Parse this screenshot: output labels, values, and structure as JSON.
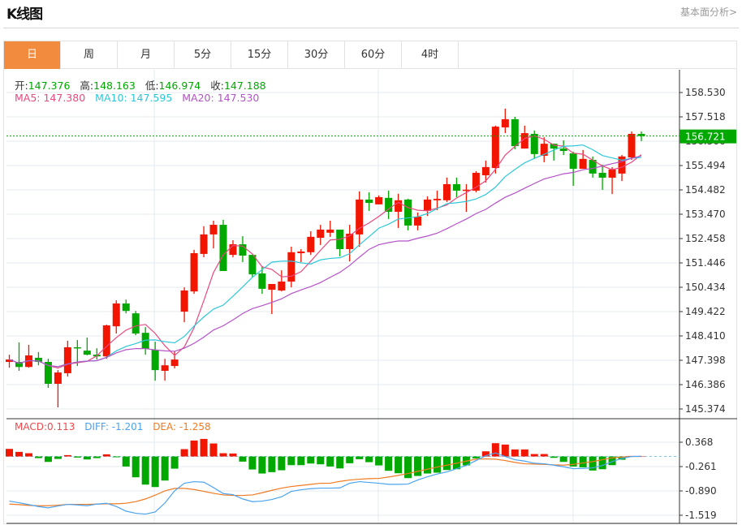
{
  "header": {
    "title": "K线图",
    "link": "基本面分析>"
  },
  "tabs": [
    {
      "label": "日",
      "active": true
    },
    {
      "label": "周"
    },
    {
      "label": "月"
    },
    {
      "label": "5分"
    },
    {
      "label": "15分"
    },
    {
      "label": "30分"
    },
    {
      "label": "60分"
    },
    {
      "label": "4时"
    }
  ],
  "ohlc": {
    "open_label": "开:",
    "open": "147.376",
    "high_label": "高:",
    "high": "148.163",
    "low_label": "低:",
    "low": "146.974",
    "close_label": "收:",
    "close": "147.188"
  },
  "ma": {
    "ma5": "MA5: 147.380",
    "ma10": "MA10: 147.595",
    "ma20": "MA20: 147.530"
  },
  "macd_info": {
    "macd": "MACD:0.113",
    "diff": "DIFF: -1.201",
    "dea": "DEA: -1.258"
  },
  "colors": {
    "up": "#f21500",
    "down": "#00a800",
    "ma5": "#e9487f",
    "ma10": "#2ec7d9",
    "ma20": "#b552c8",
    "diff": "#4aa3f0",
    "dea": "#f07a22",
    "active_tab": "#f38b3f",
    "grid": "#e3ebf2"
  },
  "chart_data": [
    {
      "type": "candlestick",
      "ylim": [
        145.374,
        158.53
      ],
      "yticks": [
        "158.530",
        "157.518",
        "156.506",
        "155.494",
        "154.482",
        "153.470",
        "152.458",
        "151.446",
        "150.434",
        "149.422",
        "148.410",
        "147.398",
        "146.386",
        "145.374"
      ],
      "last_price": "156.721",
      "grid": true,
      "ma_periods": [
        5,
        10,
        20
      ],
      "candles": [
        [
          147.33,
          147.63,
          147.09,
          147.43
        ],
        [
          147.33,
          148.14,
          146.96,
          147.12
        ],
        [
          147.12,
          148.04,
          147.09,
          147.6
        ],
        [
          147.5,
          147.74,
          147.19,
          147.33
        ],
        [
          147.33,
          147.46,
          146.25,
          146.42
        ],
        [
          146.42,
          146.99,
          145.44,
          146.89
        ],
        [
          146.86,
          148.21,
          146.72,
          147.94
        ],
        [
          147.94,
          148.24,
          147.16,
          147.9
        ],
        [
          147.8,
          148.34,
          147.6,
          147.63
        ],
        [
          147.63,
          147.9,
          147.43,
          147.56
        ],
        [
          147.56,
          148.88,
          147.46,
          148.85
        ],
        [
          148.81,
          149.89,
          148.51,
          149.76
        ],
        [
          149.76,
          149.92,
          149.35,
          149.45
        ],
        [
          149.35,
          149.45,
          148.44,
          148.51
        ],
        [
          148.54,
          148.78,
          147.63,
          147.87
        ],
        [
          147.84,
          148.17,
          146.55,
          146.99
        ],
        [
          146.96,
          147.46,
          146.55,
          147.19
        ],
        [
          147.16,
          147.77,
          147.06,
          147.43
        ],
        [
          149.42,
          150.43,
          148.98,
          150.3
        ],
        [
          150.26,
          151.99,
          150.16,
          151.85
        ],
        [
          151.82,
          152.97,
          151.68,
          152.63
        ],
        [
          152.63,
          153.2,
          152.05,
          153.03
        ],
        [
          153.03,
          153.24,
          151.11,
          151.11
        ],
        [
          151.78,
          152.39,
          151.68,
          152.22
        ],
        [
          152.22,
          152.56,
          151.48,
          151.75
        ],
        [
          151.78,
          151.78,
          150.84,
          150.97
        ],
        [
          151.01,
          151.31,
          150.16,
          150.37
        ],
        [
          150.33,
          150.57,
          149.32,
          150.57
        ],
        [
          150.3,
          151.14,
          150.26,
          150.67
        ],
        [
          150.67,
          152.12,
          150.43,
          151.89
        ],
        [
          151.85,
          152.02,
          151.48,
          151.92
        ],
        [
          151.89,
          152.76,
          151.78,
          152.53
        ],
        [
          152.49,
          153.03,
          152.19,
          152.83
        ],
        [
          152.7,
          153.2,
          152.53,
          152.83
        ],
        [
          152.83,
          152.83,
          151.72,
          152.02
        ],
        [
          152.02,
          153.03,
          151.51,
          152.66
        ],
        [
          152.63,
          154.42,
          152.12,
          154.08
        ],
        [
          154.08,
          154.38,
          153.61,
          153.94
        ],
        [
          153.88,
          154.25,
          153.88,
          154.18
        ],
        [
          154.15,
          154.45,
          153.27,
          153.57
        ],
        [
          153.57,
          154.32,
          152.9,
          154.05
        ],
        [
          154.08,
          154.11,
          152.8,
          153.0
        ],
        [
          153.0,
          153.54,
          152.8,
          153.37
        ],
        [
          153.61,
          154.21,
          153.4,
          154.08
        ],
        [
          154.05,
          154.45,
          153.64,
          154.11
        ],
        [
          154.05,
          154.99,
          153.98,
          154.72
        ],
        [
          154.72,
          154.99,
          154.18,
          154.45
        ],
        [
          154.45,
          154.72,
          153.57,
          154.49
        ],
        [
          154.45,
          155.26,
          154.38,
          155.19
        ],
        [
          155.09,
          155.7,
          154.79,
          155.43
        ],
        [
          155.39,
          157.15,
          155.16,
          157.11
        ],
        [
          157.08,
          157.86,
          156.84,
          157.42
        ],
        [
          157.42,
          157.52,
          156.17,
          156.3
        ],
        [
          156.2,
          157.15,
          156.2,
          156.84
        ],
        [
          156.81,
          156.95,
          155.77,
          155.97
        ],
        [
          155.9,
          156.67,
          155.63,
          156.4
        ],
        [
          156.4,
          156.4,
          155.7,
          156.2
        ],
        [
          156.2,
          156.54,
          155.93,
          156.1
        ],
        [
          156.0,
          156.07,
          154.65,
          155.36
        ],
        [
          155.36,
          156.14,
          155.36,
          155.77
        ],
        [
          155.73,
          155.87,
          154.99,
          155.16
        ],
        [
          155.19,
          155.53,
          154.48,
          154.99
        ],
        [
          154.99,
          155.43,
          154.31,
          155.33
        ],
        [
          155.16,
          155.93,
          154.85,
          155.87
        ],
        [
          155.83,
          156.91,
          155.73,
          156.81
        ],
        [
          156.81,
          156.91,
          156.51,
          156.72
        ]
      ]
    },
    {
      "type": "macd",
      "ylim": [
        -1.519,
        0.368
      ],
      "yticks": [
        "0.368",
        "-0.261",
        "-0.890",
        "-1.519"
      ],
      "histogram": [
        0.196,
        0.119,
        0.084,
        -0.042,
        -0.14,
        -0.063,
        0.035,
        -0.028,
        -0.077,
        -0.042,
        0.056,
        -0.021,
        -0.259,
        -0.538,
        -0.727,
        -0.79,
        -0.622,
        -0.315,
        0.189,
        0.412,
        0.454,
        0.336,
        0.084,
        0.077,
        -0.133,
        -0.336,
        -0.44,
        -0.405,
        -0.356,
        -0.224,
        -0.224,
        -0.182,
        -0.203,
        -0.259,
        -0.308,
        -0.175,
        -0.07,
        -0.147,
        -0.231,
        -0.37,
        -0.433,
        -0.559,
        -0.503,
        -0.44,
        -0.419,
        -0.35,
        -0.329,
        -0.231,
        -0.049,
        0.133,
        0.343,
        0.308,
        0.182,
        0.182,
        0.063,
        0.063,
        -0.035,
        -0.14,
        -0.259,
        -0.28,
        -0.363,
        -0.329,
        -0.224,
        -0.084,
        0.014,
        0.0
      ],
      "diff": [
        -1.153,
        -1.195,
        -1.244,
        -1.293,
        -1.328,
        -1.279,
        -1.237,
        -1.251,
        -1.272,
        -1.23,
        -1.209,
        -1.293,
        -1.412,
        -1.468,
        -1.489,
        -1.433,
        -1.202,
        -0.888,
        -0.692,
        -0.65,
        -0.664,
        -0.804,
        -0.958,
        -0.986,
        -1.097,
        -1.167,
        -1.153,
        -1.111,
        -1.042,
        -0.902,
        -0.86,
        -0.832,
        -0.818,
        -0.818,
        -0.811,
        -0.692,
        -0.65,
        -0.671,
        -0.692,
        -0.72,
        -0.72,
        -0.713,
        -0.608,
        -0.524,
        -0.454,
        -0.398,
        -0.315,
        -0.231,
        -0.105,
        0.021,
        0.091,
        0.0,
        -0.084,
        -0.119,
        -0.175,
        -0.189,
        -0.224,
        -0.266,
        -0.315,
        -0.308,
        -0.294,
        -0.231,
        -0.133,
        -0.049,
        0.0,
        0.007
      ],
      "dea": [
        -1.23,
        -1.244,
        -1.265,
        -1.272,
        -1.272,
        -1.258,
        -1.237,
        -1.237,
        -1.237,
        -1.23,
        -1.223,
        -1.223,
        -1.209,
        -1.167,
        -1.097,
        -1.0,
        -0.888,
        -0.825,
        -0.825,
        -0.853,
        -0.902,
        -0.951,
        -0.993,
        -1.007,
        -1.007,
        -0.993,
        -0.937,
        -0.874,
        -0.818,
        -0.776,
        -0.748,
        -0.72,
        -0.692,
        -0.692,
        -0.643,
        -0.608,
        -0.587,
        -0.573,
        -0.566,
        -0.531,
        -0.489,
        -0.44,
        -0.384,
        -0.329,
        -0.273,
        -0.224,
        -0.175,
        -0.119,
        -0.07,
        -0.063,
        -0.07,
        -0.105,
        -0.154,
        -0.189,
        -0.196,
        -0.203,
        -0.217,
        -0.224,
        -0.203,
        -0.168,
        -0.133,
        -0.084,
        -0.035,
        -0.014,
        0.0,
        0.0
      ]
    }
  ]
}
